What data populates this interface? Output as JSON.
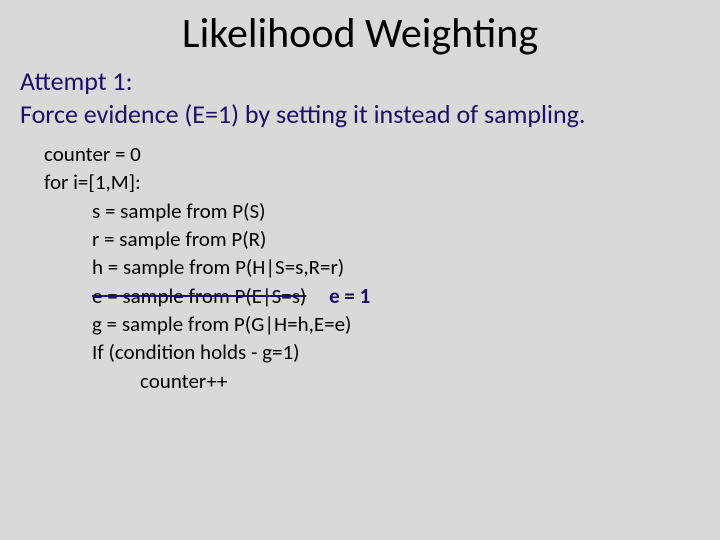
{
  "title": "Likelihood Weighting",
  "subtitle_line1": "Attempt 1:",
  "subtitle_line2": "Force evidence (E=1) by setting it instead of sampling.",
  "code": {
    "l1": "counter = 0",
    "l2": "for i=[1,M]:",
    "l3": "s = sample from P(S)",
    "l4": "r = sample from P(R)",
    "l5": "h = sample from P(H|S=s,R=r)",
    "l6_struck": "e = sample from P(E|S=s)",
    "l6_repl": "e = 1",
    "l7": "g = sample from P(G|H=h,E=e)",
    "l8": "If (condition holds - g=1)",
    "l9": "counter++"
  }
}
